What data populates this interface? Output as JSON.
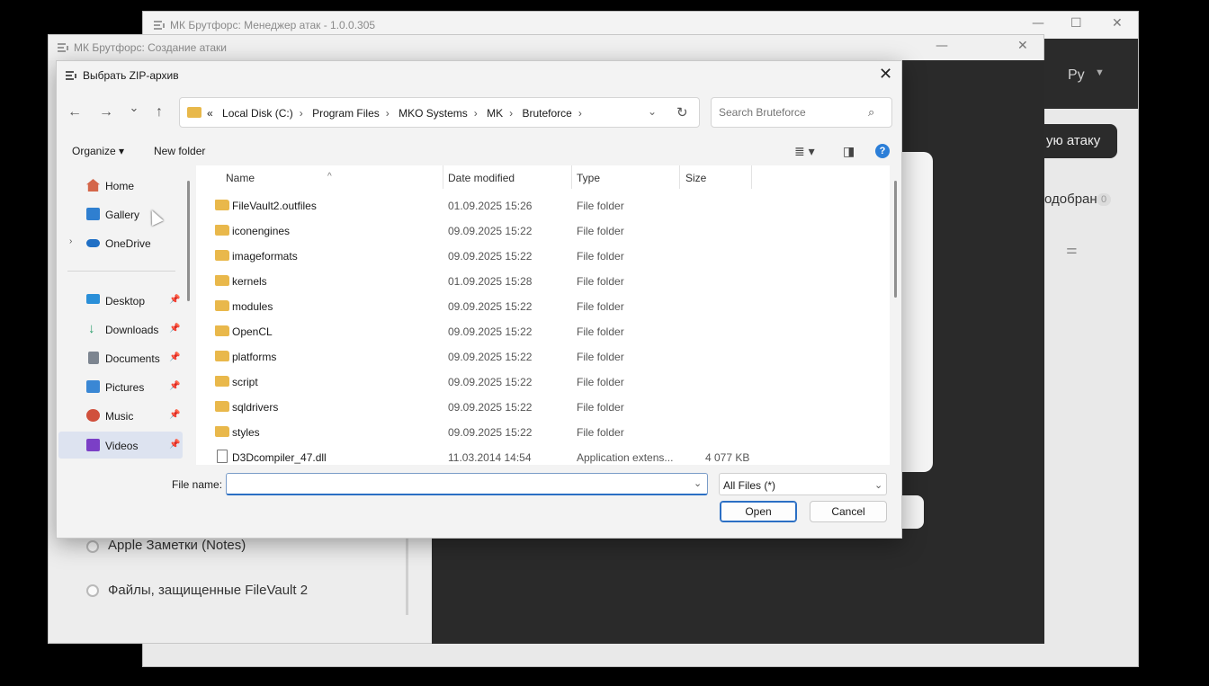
{
  "manager_window": {
    "title": "МК Брутфорс: Менеджер атак - 1.0.0.305",
    "language": "Ру",
    "new_attack_partial": "ую атаку",
    "found_partial": "одобран",
    "found_count": "0",
    "minimize": "—",
    "maximize": "☐",
    "close": "✕"
  },
  "create_window": {
    "title": "МК Брутфорс: Создание атаки",
    "minimize": "—",
    "close": "✕",
    "options": [
      {
        "label": "Apple Заметки (Notes)"
      },
      {
        "label": "Файлы, защищенные FileVault 2"
      }
    ]
  },
  "dialog": {
    "title": "Выбрать ZIP-архив",
    "close": "✕",
    "nav": {
      "back": "←",
      "forward": "→",
      "recent": "⌄",
      "up": "↑"
    },
    "breadcrumb": {
      "prefix": "«",
      "items": [
        "Local Disk (C:)",
        "Program Files",
        "MKO Systems",
        "MK",
        "Bruteforce"
      ],
      "separator": "›"
    },
    "search_placeholder": "Search Bruteforce",
    "toolbar": {
      "organize": "Organize ▾",
      "new_folder": "New folder",
      "help": "?"
    },
    "sidebar": [
      {
        "label": "Home",
        "icon": "home-icon",
        "color": "#d4664a"
      },
      {
        "label": "Gallery",
        "icon": "gallery-icon",
        "color": "#2f7fd0"
      },
      {
        "label": "OneDrive",
        "icon": "cloud-icon",
        "color": "#1f6fc5"
      },
      {
        "label": "Desktop",
        "icon": "desktop-icon",
        "color": "#2a8fd8"
      },
      {
        "label": "Downloads",
        "icon": "download-icon",
        "color": "#2a9d6a"
      },
      {
        "label": "Documents",
        "icon": "documents-icon",
        "color": "#7d8590"
      },
      {
        "label": "Pictures",
        "icon": "pictures-icon",
        "color": "#3a87d4"
      },
      {
        "label": "Music",
        "icon": "music-icon",
        "color": "#d0503c"
      },
      {
        "label": "Videos",
        "icon": "videos-icon",
        "color": "#7b3fc6"
      }
    ],
    "columns": [
      "Name",
      "Date modified",
      "Type",
      "Size"
    ],
    "files": [
      {
        "name": "FileVault2.outfiles",
        "date": "01.09.2025 15:26",
        "type": "File folder",
        "size": ""
      },
      {
        "name": "iconengines",
        "date": "09.09.2025 15:22",
        "type": "File folder",
        "size": ""
      },
      {
        "name": "imageformats",
        "date": "09.09.2025 15:22",
        "type": "File folder",
        "size": ""
      },
      {
        "name": "kernels",
        "date": "01.09.2025 15:28",
        "type": "File folder",
        "size": ""
      },
      {
        "name": "modules",
        "date": "09.09.2025 15:22",
        "type": "File folder",
        "size": ""
      },
      {
        "name": "OpenCL",
        "date": "09.09.2025 15:22",
        "type": "File folder",
        "size": ""
      },
      {
        "name": "platforms",
        "date": "09.09.2025 15:22",
        "type": "File folder",
        "size": ""
      },
      {
        "name": "script",
        "date": "09.09.2025 15:22",
        "type": "File folder",
        "size": ""
      },
      {
        "name": "sqldrivers",
        "date": "09.09.2025 15:22",
        "type": "File folder",
        "size": ""
      },
      {
        "name": "styles",
        "date": "09.09.2025 15:22",
        "type": "File folder",
        "size": ""
      },
      {
        "name": "D3Dcompiler_47.dll",
        "date": "11.03.2014 14:54",
        "type": "Application extens...",
        "size": "4 077 KB"
      }
    ],
    "file_name_label": "File name:",
    "file_name_value": "",
    "file_type_filter": "All Files (*)",
    "open_label": "Open",
    "cancel_label": "Cancel"
  }
}
